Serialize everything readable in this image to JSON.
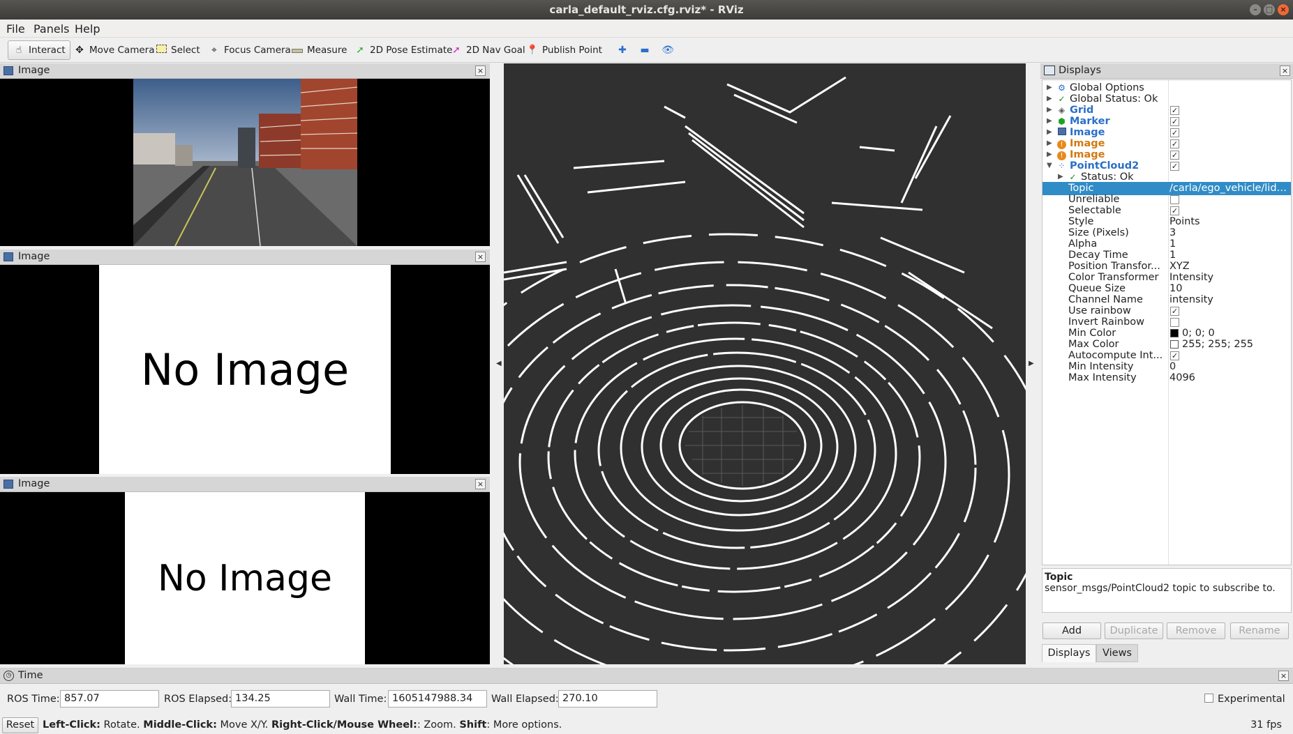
{
  "window": {
    "title": "carla_default_rviz.cfg.rviz* - RViz"
  },
  "menu": [
    "File",
    "Panels",
    "Help"
  ],
  "toolbar": {
    "interact": "Interact",
    "move_camera": "Move Camera",
    "select": "Select",
    "focus_camera": "Focus Camera",
    "measure": "Measure",
    "pose_estimate": "2D Pose Estimate",
    "nav_goal": "2D Nav Goal",
    "publish_point": "Publish Point"
  },
  "image_panels": [
    {
      "title": "Image"
    },
    {
      "title": "Image",
      "text": "No Image"
    },
    {
      "title": "Image",
      "text": "No Image"
    }
  ],
  "displays": {
    "title": "Displays",
    "items": [
      {
        "label": "Global Options",
        "style": "normal"
      },
      {
        "label": "Global Status: Ok",
        "style": "normal"
      },
      {
        "label": "Grid",
        "style": "blue",
        "checked": true
      },
      {
        "label": "Marker",
        "style": "blue",
        "checked": true
      },
      {
        "label": "Image",
        "style": "blue",
        "checked": true
      },
      {
        "label": "Image",
        "style": "orange",
        "checked": true
      },
      {
        "label": "Image",
        "style": "orange",
        "checked": true
      },
      {
        "label": "PointCloud2",
        "style": "blue",
        "checked": true
      },
      {
        "label": "Status: Ok",
        "style": "normal"
      }
    ],
    "properties": [
      {
        "name": "Topic",
        "value": "/carla/ego_vehicle/lida..."
      },
      {
        "name": "Unreliable",
        "check": false
      },
      {
        "name": "Selectable",
        "check": true
      },
      {
        "name": "Style",
        "value": "Points"
      },
      {
        "name": "Size (Pixels)",
        "value": "3"
      },
      {
        "name": "Alpha",
        "value": "1"
      },
      {
        "name": "Decay Time",
        "value": "1"
      },
      {
        "name": "Position Transfor...",
        "value": "XYZ"
      },
      {
        "name": "Color Transformer",
        "value": "Intensity"
      },
      {
        "name": "Queue Size",
        "value": "10"
      },
      {
        "name": "Channel Name",
        "value": "intensity"
      },
      {
        "name": "Use rainbow",
        "check": true
      },
      {
        "name": "Invert Rainbow",
        "check": false
      },
      {
        "name": "Min Color",
        "value": "0; 0; 0",
        "swatch": "#000000"
      },
      {
        "name": "Max Color",
        "value": "255; 255; 255",
        "swatch": "#ffffff"
      },
      {
        "name": "Autocompute Int...",
        "check": true
      },
      {
        "name": "Min Intensity",
        "value": "0"
      },
      {
        "name": "Max Intensity",
        "value": "4096"
      }
    ],
    "help_title": "Topic",
    "help_text": "sensor_msgs/PointCloud2 topic to subscribe to.",
    "buttons": {
      "add": "Add",
      "duplicate": "Duplicate",
      "remove": "Remove",
      "rename": "Rename"
    },
    "tabs": {
      "displays": "Displays",
      "views": "Views"
    }
  },
  "time": {
    "title": "Time",
    "ros_time_label": "ROS Time:",
    "ros_time": "857.07",
    "ros_elapsed_label": "ROS Elapsed:",
    "ros_elapsed": "134.25",
    "wall_time_label": "Wall Time:",
    "wall_time": "1605147988.34",
    "wall_elapsed_label": "Wall Elapsed:",
    "wall_elapsed": "270.10",
    "experimental": "Experimental"
  },
  "status": {
    "reset": "Reset",
    "left_click": "Left-Click:",
    "left_click_desc": " Rotate. ",
    "middle_click": "Middle-Click:",
    "middle_click_desc": " Move X/Y. ",
    "right_click": "Right-Click/Mouse Wheel:",
    "right_click_desc": ": Zoom. ",
    "shift": "Shift",
    "shift_desc": ": More options.",
    "fps": "31 fps"
  }
}
